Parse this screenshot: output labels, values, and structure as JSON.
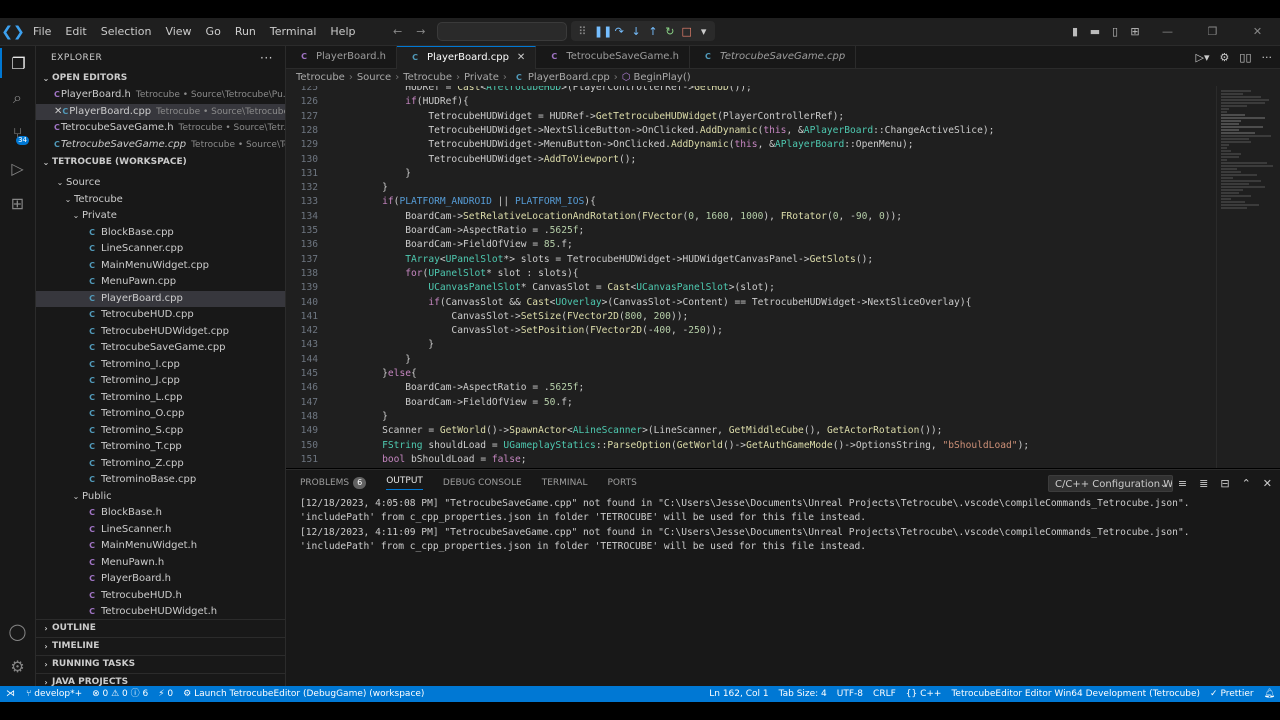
{
  "titlebar": {
    "logo": "VS",
    "menu": [
      "File",
      "Edit",
      "Selection",
      "View",
      "Go",
      "Run",
      "Terminal",
      "Help"
    ],
    "command_center_placeholder": ""
  },
  "activity": {
    "source_control_badge": "34"
  },
  "sidebar": {
    "title": "EXPLORER",
    "open_editors_label": "OPEN EDITORS",
    "open_editors": [
      {
        "name": "PlayerBoard.h",
        "desc": "Tetrocube • Source\\Tetrocube\\Pu...",
        "type": "h"
      },
      {
        "name": "PlayerBoard.cpp",
        "desc": "Tetrocube • Source\\Tetrocube\\...",
        "type": "c"
      },
      {
        "name": "TetrocubeSaveGame.h",
        "desc": "Tetrocube • Source\\Tetr...",
        "type": "h"
      },
      {
        "name": "TetrocubeSaveGame.cpp",
        "desc": "Tetrocube • Source\\Tet...",
        "type": "c"
      }
    ],
    "workspace_label": "TETROCUBE (WORKSPACE)",
    "folders": {
      "source": "Source",
      "tetrocube": "Tetrocube",
      "private": "Private",
      "public": "Public"
    },
    "private_files": [
      "BlockBase.cpp",
      "LineScanner.cpp",
      "MainMenuWidget.cpp",
      "MenuPawn.cpp",
      "PlayerBoard.cpp",
      "TetrocubeHUD.cpp",
      "TetrocubeHUDWidget.cpp",
      "TetrocubeSaveGame.cpp",
      "Tetromino_I.cpp",
      "Tetromino_J.cpp",
      "Tetromino_L.cpp",
      "Tetromino_O.cpp",
      "Tetromino_S.cpp",
      "Tetromino_T.cpp",
      "Tetromino_Z.cpp",
      "TetrominoBase.cpp"
    ],
    "public_files": [
      "BlockBase.h",
      "LineScanner.h",
      "MainMenuWidget.h",
      "MenuPawn.h",
      "PlayerBoard.h",
      "TetrocubeHUD.h",
      "TetrocubeHUDWidget.h"
    ],
    "bottom_sections": [
      "OUTLINE",
      "TIMELINE",
      "RUNNING TASKS",
      "JAVA PROJECTS"
    ]
  },
  "tabs": [
    {
      "label": "PlayerBoard.h",
      "type": "h"
    },
    {
      "label": "PlayerBoard.cpp",
      "type": "c"
    },
    {
      "label": "TetrocubeSaveGame.h",
      "type": "h"
    },
    {
      "label": "TetrocubeSaveGame.cpp",
      "type": "c"
    }
  ],
  "breadcrumb": [
    "Tetrocube",
    "Source",
    "Tetrocube",
    "Private",
    "PlayerBoard.cpp",
    "BeginPlay()"
  ],
  "code_lines": [
    {
      "n": "125",
      "text": "        HUDRef = Cast<ATetrocubeHUD>(PlayerControllerRef->GetHUD());"
    },
    {
      "n": "126",
      "text": "        if(HUDRef){"
    },
    {
      "n": "127",
      "text": "            TetrocubeHUDWidget = HUDRef->GetTetrocubeHUDWidget(PlayerControllerRef);"
    },
    {
      "n": "128",
      "text": "            TetrocubeHUDWidget->NextSliceButton->OnClicked.AddDynamic(this, &APlayerBoard::ChangeActiveSlice);"
    },
    {
      "n": "129",
      "text": "            TetrocubeHUDWidget->MenuButton->OnClicked.AddDynamic(this, &APlayerBoard::OpenMenu);"
    },
    {
      "n": "130",
      "text": "            TetrocubeHUDWidget->AddToViewport();"
    },
    {
      "n": "131",
      "text": "        }"
    },
    {
      "n": "132",
      "text": "    }"
    },
    {
      "n": "133",
      "text": "    if(PLATFORM_ANDROID || PLATFORM_IOS){"
    },
    {
      "n": "134",
      "text": "        BoardCam->SetRelativeLocationAndRotation(FVector(0, 1600, 1000), FRotator(0, -90, 0));"
    },
    {
      "n": "135",
      "text": "        BoardCam->AspectRatio = .5625f;"
    },
    {
      "n": "136",
      "text": "        BoardCam->FieldOfView = 85.f;"
    },
    {
      "n": "137",
      "text": "        TArray<UPanelSlot*> slots = TetrocubeHUDWidget->HUDWidgetCanvasPanel->GetSlots();"
    },
    {
      "n": "138",
      "text": "        for(UPanelSlot* slot : slots){"
    },
    {
      "n": "139",
      "text": "            UCanvasPanelSlot* CanvasSlot = Cast<UCanvasPanelSlot>(slot);"
    },
    {
      "n": "140",
      "text": "            if(CanvasSlot && Cast<UOverlay>(CanvasSlot->Content) == TetrocubeHUDWidget->NextSliceOverlay){"
    },
    {
      "n": "141",
      "text": "                CanvasSlot->SetSize(FVector2D(800, 200));"
    },
    {
      "n": "142",
      "text": "                CanvasSlot->SetPosition(FVector2D(-400, -250));"
    },
    {
      "n": "143",
      "text": "            }"
    },
    {
      "n": "144",
      "text": "        }"
    },
    {
      "n": "145",
      "text": "    }else{"
    },
    {
      "n": "146",
      "text": "        BoardCam->AspectRatio = .5625f;"
    },
    {
      "n": "147",
      "text": "        BoardCam->FieldOfView = 50.f;"
    },
    {
      "n": "148",
      "text": "    }"
    },
    {
      "n": "149",
      "text": "    Scanner = GetWorld()->SpawnActor<ALineScanner>(LineScanner, GetMiddleCube(), GetActorRotation());"
    },
    {
      "n": "150",
      "text": "    FString shouldLoad = UGameplayStatics::ParseOption(GetWorld()->GetAuthGameMode()->OptionsString, \"bShouldLoad\");"
    },
    {
      "n": "151",
      "text": "    bool bShouldLoad = false;"
    }
  ],
  "panel": {
    "tabs": [
      "PROBLEMS",
      "OUTPUT",
      "DEBUG CONSOLE",
      "TERMINAL",
      "PORTS"
    ],
    "problems_count": "6",
    "output_channel": "C/C++ Configuration W",
    "lines": [
      "[12/18/2023, 4:05:08 PM] \"TetrocubeSaveGame.cpp\" not found in \"C:\\Users\\Jesse\\Documents\\Unreal Projects\\Tetrocube\\.vscode\\compileCommands_Tetrocube.json\".",
      "'includePath' from c_cpp_properties.json in folder 'TETROCUBE' will be used for this file instead.",
      "[12/18/2023, 4:11:09 PM] \"TetrocubeSaveGame.cpp\" not found in \"C:\\Users\\Jesse\\Documents\\Unreal Projects\\Tetrocube\\.vscode\\compileCommands_Tetrocube.json\".",
      "'includePath' from c_cpp_properties.json in folder 'TETROCUBE' will be used for this file instead."
    ]
  },
  "status": {
    "branch": "develop*+",
    "problems": "⊗ 0 ⚠ 0 ⓘ 6",
    "ports": "⚡ 0",
    "launch": "Launch TetrocubeEditor (DebugGame) (workspace)",
    "position": "Ln 162, Col 1",
    "tab_size": "Tab Size: 4",
    "encoding": "UTF-8",
    "eol": "CRLF",
    "language": "{} C++",
    "config": "TetrocubeEditor Editor Win64 Development (Tetrocube)",
    "prettier": "✓ Prettier"
  },
  "colors": {
    "accent": "#0078d4",
    "statusbar": "#0078d4",
    "editor_bg": "#1f1f1f"
  }
}
